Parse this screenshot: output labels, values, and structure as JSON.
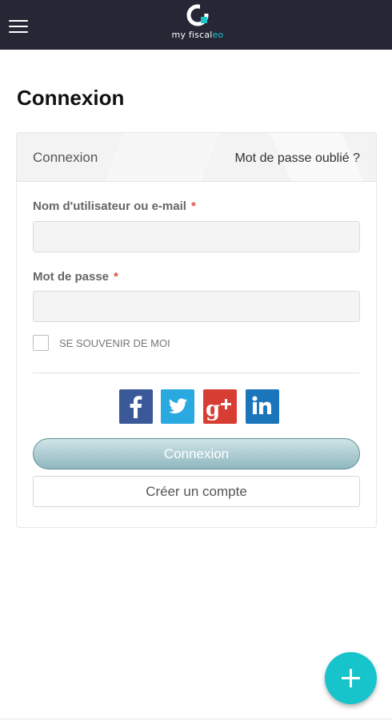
{
  "header": {
    "logo": {
      "text_plain": "my fiscal",
      "text_accent": "eo",
      "icon": "myfiscaleo-logo-icon"
    },
    "menu_icon": "hamburger-menu-icon"
  },
  "page": {
    "title": "Connexion"
  },
  "card": {
    "tab_login": "Connexion",
    "forgot_password": "Mot de passe oublié ?"
  },
  "form": {
    "username_label": "Nom d'utilisateur ou e-mail",
    "username_required": "*",
    "username_value": "",
    "password_label": "Mot de passe",
    "password_required": "*",
    "password_value": "",
    "remember_label": "SE SOUVENIR DE MOI",
    "remember_checked": false
  },
  "social": {
    "items": [
      {
        "name": "facebook",
        "icon": "facebook-icon",
        "color": "#3b5998"
      },
      {
        "name": "twitter",
        "icon": "twitter-icon",
        "color": "#2aa9e0"
      },
      {
        "name": "google-plus",
        "icon": "google-plus-icon",
        "color": "#d73d32"
      },
      {
        "name": "linkedin",
        "icon": "linkedin-icon",
        "color": "#1b75bb"
      }
    ]
  },
  "actions": {
    "login_button": "Connexion",
    "create_account_button": "Créer un compte"
  },
  "fab": {
    "icon": "plus-icon",
    "color": "#17c4cc"
  },
  "colors": {
    "topbar": "#262634",
    "accent": "#19c7c9",
    "required": "#e24a3b"
  }
}
